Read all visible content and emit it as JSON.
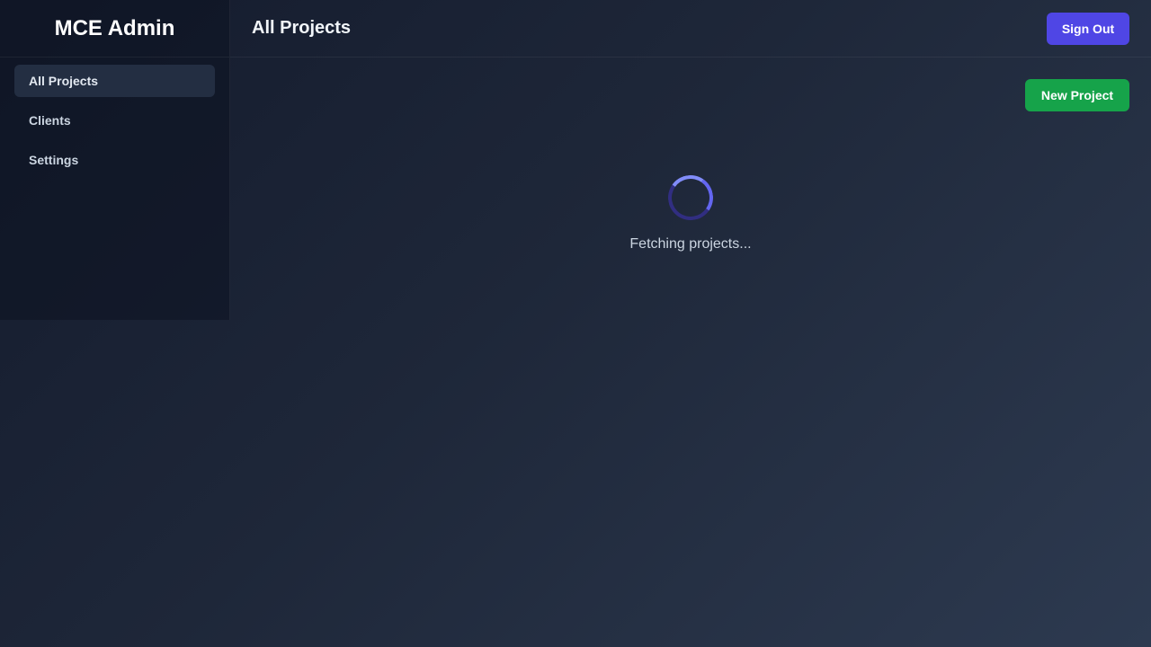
{
  "sidebar": {
    "brand": "MCE Admin",
    "items": [
      {
        "label": "All Projects",
        "active": true
      },
      {
        "label": "Clients"
      },
      {
        "label": "Settings"
      }
    ]
  },
  "header": {
    "title": "All Projects",
    "sign_out_label": "Sign Out"
  },
  "main": {
    "new_project_label": "New Project",
    "loading_text": "Fetching projects..."
  },
  "colors": {
    "primary": "#4f46e5",
    "success": "#16a34a",
    "spinner": "#818cf8"
  },
  "icons": {
    "spinner": "loading-spinner-icon"
  }
}
